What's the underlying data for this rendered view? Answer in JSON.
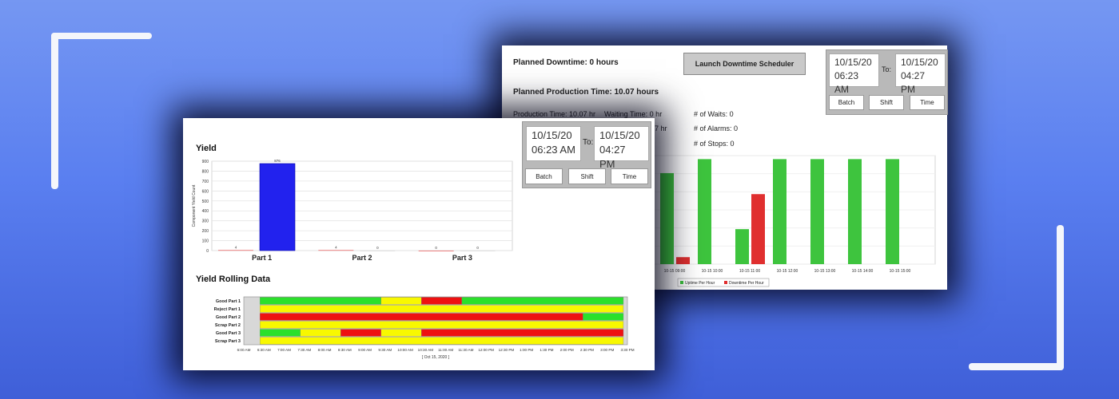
{
  "colors": {
    "background": "#5a7ff0",
    "yield_bar": "#2222ee",
    "reject_bar": "#e03030",
    "uptime": "#3ec43e",
    "downtime": "#e02f2f",
    "gantt_green": "#2be02b",
    "gantt_yellow": "#f8f800",
    "gantt_red": "#ee1111"
  },
  "downtime_panel": {
    "planned_downtime": "Planned Downtime: 0 hours",
    "planned_production": "Planned Production Time: 10.07 hours",
    "launch_button": "Launch Downtime Scheduler",
    "production_time": "Production Time: 10.07 hr",
    "waiting_time": "Waiting Time: 0 hr",
    "partial_value": "07 hr",
    "waits": "# of Waits: 0",
    "alarms": "# of Alarms: 0",
    "stops": "# of Stops: 0",
    "date_from": [
      "10/15/20",
      "06:23 AM"
    ],
    "date_to": [
      "10/15/20",
      "04:27 PM"
    ],
    "to_label": "To:",
    "buttons": [
      "Batch",
      "Shift",
      "Time"
    ]
  },
  "yield_panel": {
    "title": "Yield",
    "rolling_title": "Yield Rolling Data",
    "date_from": [
      "10/15/20",
      "06:23 AM"
    ],
    "date_to": [
      "10/15/20",
      "04:27 PM"
    ],
    "to_label": "To:",
    "buttons": [
      "Batch",
      "Shift",
      "Time"
    ]
  },
  "chart_data": [
    {
      "type": "bar",
      "title": "Yield",
      "ylabel": "Component Yield Count",
      "ylim": [
        0,
        900
      ],
      "yticks": [
        0,
        100,
        200,
        300,
        400,
        500,
        600,
        700,
        800,
        900
      ],
      "categories": [
        "Part 1",
        "Part 2",
        "Part 3"
      ],
      "series": [
        {
          "values": [
            4,
            4,
            0
          ]
        },
        {
          "values": [
            876,
            0,
            0
          ]
        }
      ],
      "grid": true
    },
    {
      "type": "bar",
      "x": [
        "10-15 09:00",
        "10-15 10:00",
        "10-15 11:00",
        "10-15 12:00",
        "10-15 13:00",
        "10-15 14:00",
        "10-15 15:00"
      ],
      "x_partial": [
        "",
        "10-15 09:00",
        "",
        "10-15 10:00",
        "",
        "10-15 11:00",
        "",
        "10-15 12:00",
        "",
        "10-15 13:00",
        "",
        "10-15 14:00",
        "",
        "10-15 15:00"
      ],
      "ylim": [
        0,
        62
      ],
      "series": [
        {
          "name": "Uptime Per Hour",
          "values": [
            52,
            60,
            20,
            60,
            60,
            60,
            60
          ]
        },
        {
          "name": "Downtime Per Hour",
          "values": [
            4,
            0,
            40,
            0,
            0,
            0,
            0
          ]
        }
      ],
      "legend": "bottom-center",
      "grid": true
    },
    {
      "type": "heatmap",
      "title": "Yield Rolling Data",
      "rows": [
        "Good Part 1",
        "Reject Part 1",
        "Good Part 2",
        "Scrap Part 2",
        "Good Part 3",
        "Scrap Part 3"
      ],
      "x_ticks": [
        "6:00 AM",
        "6:30 AM",
        "7:00 AM",
        "7:30 AM",
        "8:00 AM",
        "8:30 AM",
        "9:00 AM",
        "9:30 AM",
        "10:00 AM",
        "10:30 AM",
        "11:00 AM",
        "11:30 AM",
        "12:00 PM",
        "12:30 PM",
        "1:00 PM",
        "1:30 PM",
        "2:00 PM",
        "2:30 PM",
        "3:00 PM",
        "3:30 PM"
      ],
      "x_label": "[ Oct 15, 2020 ]",
      "segments": [
        [
          [
            "green",
            6.4,
            9.4
          ],
          [
            "yellow",
            9.4,
            10.4
          ],
          [
            "red",
            10.4,
            11.4
          ],
          [
            "green",
            11.4,
            15.4
          ]
        ],
        [
          [
            "yellow",
            6.4,
            15.4
          ]
        ],
        [
          [
            "red",
            6.4,
            14.4
          ],
          [
            "green",
            14.4,
            15.4
          ]
        ],
        [
          [
            "yellow",
            6.4,
            15.4
          ]
        ],
        [
          [
            "green",
            6.4,
            7.4
          ],
          [
            "yellow",
            7.4,
            8.4
          ],
          [
            "red",
            8.4,
            9.4
          ],
          [
            "yellow",
            9.4,
            10.4
          ],
          [
            "red",
            10.4,
            15.4
          ]
        ],
        [
          [
            "yellow",
            6.4,
            15.4
          ]
        ]
      ]
    }
  ]
}
